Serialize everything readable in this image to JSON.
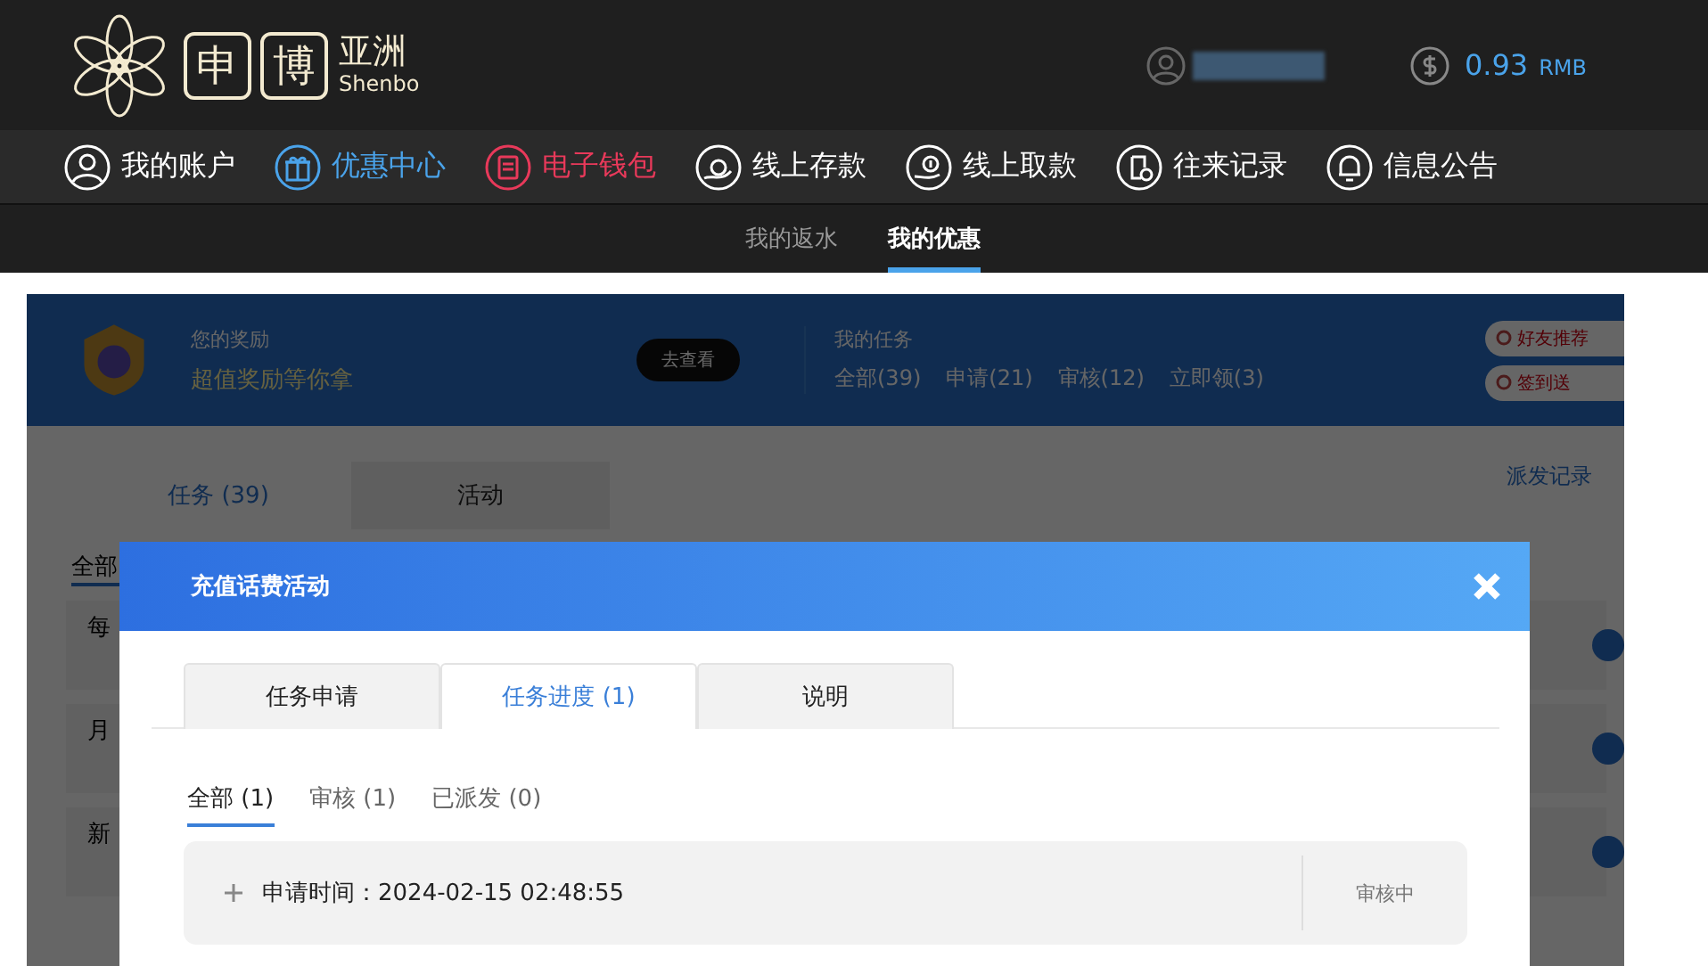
{
  "header": {
    "logo": {
      "chars": [
        "申",
        "博"
      ],
      "region": "亚洲",
      "latin": "Shenbo"
    },
    "balance": "0.93",
    "currency": "RMB"
  },
  "nav": [
    {
      "label": "我的账户",
      "kind": "account",
      "color": "#ffffff"
    },
    {
      "label": "优惠中心",
      "kind": "gift",
      "color": "#4aa3ea"
    },
    {
      "label": "电子钱包",
      "kind": "wallet",
      "color": "#e8395a"
    },
    {
      "label": "线上存款",
      "kind": "deposit",
      "color": "#ffffff"
    },
    {
      "label": "线上取款",
      "kind": "withdraw",
      "color": "#ffffff"
    },
    {
      "label": "往来记录",
      "kind": "records",
      "color": "#ffffff"
    },
    {
      "label": "信息公告",
      "kind": "bell",
      "color": "#ffffff"
    }
  ],
  "subnav": [
    {
      "label": "我的返水",
      "selected": false
    },
    {
      "label": "我的优惠",
      "selected": true
    }
  ],
  "background": {
    "reward": {
      "caption": "您的奖励",
      "text": "超值奖励等你拿",
      "button": "去查看"
    },
    "tasks": {
      "caption": "我的任务",
      "counts": [
        "全部(39)",
        "申请(21)",
        "审核(12)",
        "立即领(3)"
      ]
    },
    "side_buttons": [
      "好友推荐",
      "签到送"
    ],
    "tabs": [
      {
        "label": "任务 (39)",
        "selected": true
      },
      {
        "label": "活动",
        "selected": false
      }
    ],
    "link": "派发记录",
    "filter": "全部",
    "items": [
      {
        "title": "每"
      },
      {
        "title": "月"
      },
      {
        "title": "新"
      }
    ]
  },
  "modal": {
    "title": "充值话费活动",
    "tabs": [
      {
        "label": "任务申请",
        "selected": false
      },
      {
        "label": "任务进度 (1)",
        "selected": true
      },
      {
        "label": "说明",
        "selected": false
      }
    ],
    "filters": [
      {
        "label": "全部 (1)",
        "selected": true
      },
      {
        "label": "审核 (1)",
        "selected": false
      },
      {
        "label": "已派发 (0)",
        "selected": false
      }
    ],
    "records": [
      {
        "label": "申请时间：",
        "time": "2024-02-15 02:48:55",
        "status": "审核中",
        "expanded": false
      }
    ]
  }
}
